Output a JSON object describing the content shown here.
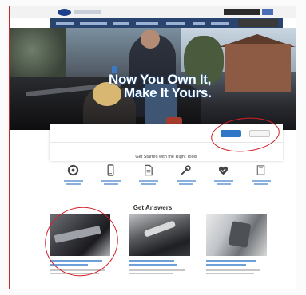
{
  "hero": {
    "title_line1": "Now You Own It,",
    "title_line2": "Make It Yours."
  },
  "panel": {
    "tools_heading": "Get Started with the Right Tools",
    "tools": [
      {
        "icon": "gauge-icon"
      },
      {
        "icon": "phone-icon"
      },
      {
        "icon": "document-icon"
      },
      {
        "icon": "wrench-icon"
      },
      {
        "icon": "heart-check-icon"
      },
      {
        "icon": "book-icon"
      }
    ]
  },
  "answers": {
    "heading": "Get Answers",
    "cards": [
      {},
      {},
      {}
    ]
  },
  "colors": {
    "accent": "#2f77c7",
    "nav": "#2a4470",
    "annotation": "#d21f25"
  }
}
